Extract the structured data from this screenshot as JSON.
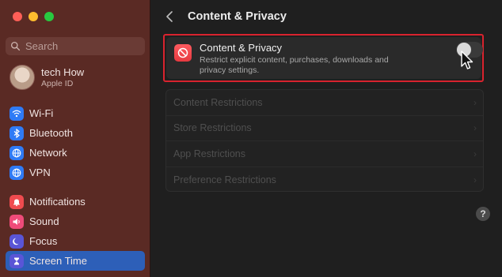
{
  "sidebar": {
    "search_placeholder": "Search",
    "profile": {
      "name": "tech How",
      "sub": "Apple ID"
    },
    "items": [
      {
        "label": "Wi-Fi",
        "icon": "wifi-icon",
        "color": "#2f7bf6"
      },
      {
        "label": "Bluetooth",
        "icon": "bluetooth-icon",
        "color": "#2f7bf6"
      },
      {
        "label": "Network",
        "icon": "globe-icon",
        "color": "#2f7bf6"
      },
      {
        "label": "VPN",
        "icon": "vpn-globe-icon",
        "color": "#2f7bf6"
      },
      {
        "label": "Notifications",
        "icon": "bell-icon",
        "color": "#ef4b4f"
      },
      {
        "label": "Sound",
        "icon": "speaker-icon",
        "color": "#ef4b79"
      },
      {
        "label": "Focus",
        "icon": "moon-icon",
        "color": "#5a55d6"
      },
      {
        "label": "Screen Time",
        "icon": "hourglass-icon",
        "color": "#5a55d6"
      }
    ],
    "active_item": "Screen Time"
  },
  "main": {
    "title": "Content & Privacy",
    "card": {
      "title": "Content & Privacy",
      "description": "Restrict explicit content, purchases, downloads and privacy settings.",
      "toggle_on": false
    },
    "restrictions": [
      {
        "label": "Content Restrictions"
      },
      {
        "label": "Store Restrictions"
      },
      {
        "label": "App Restrictions"
      },
      {
        "label": "Preference Restrictions"
      }
    ],
    "help_label": "?"
  },
  "colors": {
    "sidebar_bg": "#5a2a24",
    "active_bg": "#2d5fb8",
    "highlight_border": "#d9232e",
    "cp_icon": "#ff5a5f"
  }
}
